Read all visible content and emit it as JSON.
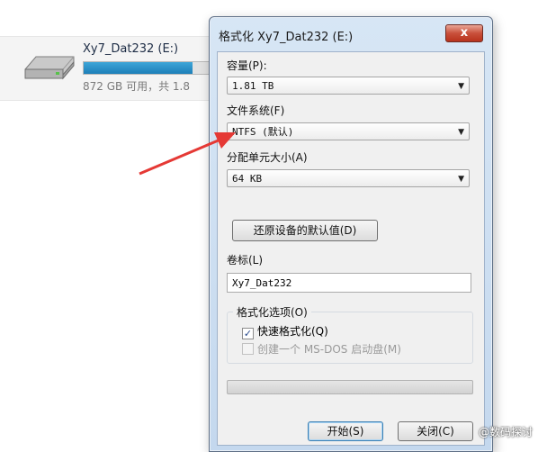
{
  "explorer": {
    "drive_name": "Xy7_Dat232 (E:)",
    "space_text": "872 GB 可用，共 1.8",
    "usage_fraction": 0.85
  },
  "dialog": {
    "title": "格式化 Xy7_Dat232 (E:)",
    "close_glyph": "x",
    "capacity_label": "容量(P):",
    "capacity_value": "1.81 TB",
    "filesystem_label": "文件系统(F)",
    "filesystem_value": "NTFS (默认)",
    "unit_label": "分配单元大小(A)",
    "unit_value": "64 KB",
    "restore_button": "还原设备的默认值(D)",
    "volume_label": "卷标(L)",
    "volume_value": "Xy7_Dat232",
    "options_title": "格式化选项(O)",
    "quick_format": "快速格式化(Q)",
    "quick_format_checked": true,
    "msdos_label": "创建一个 MS-DOS 启动盘(M)",
    "msdos_checked": false,
    "progress_fraction": 0,
    "start_button": "开始(S)",
    "close_button": "关闭(C)"
  },
  "watermark": "@数码探讨",
  "colors": {
    "arrow": "#e53935",
    "titlebar": "#c8dcf0",
    "close_button": "#c9503b"
  }
}
